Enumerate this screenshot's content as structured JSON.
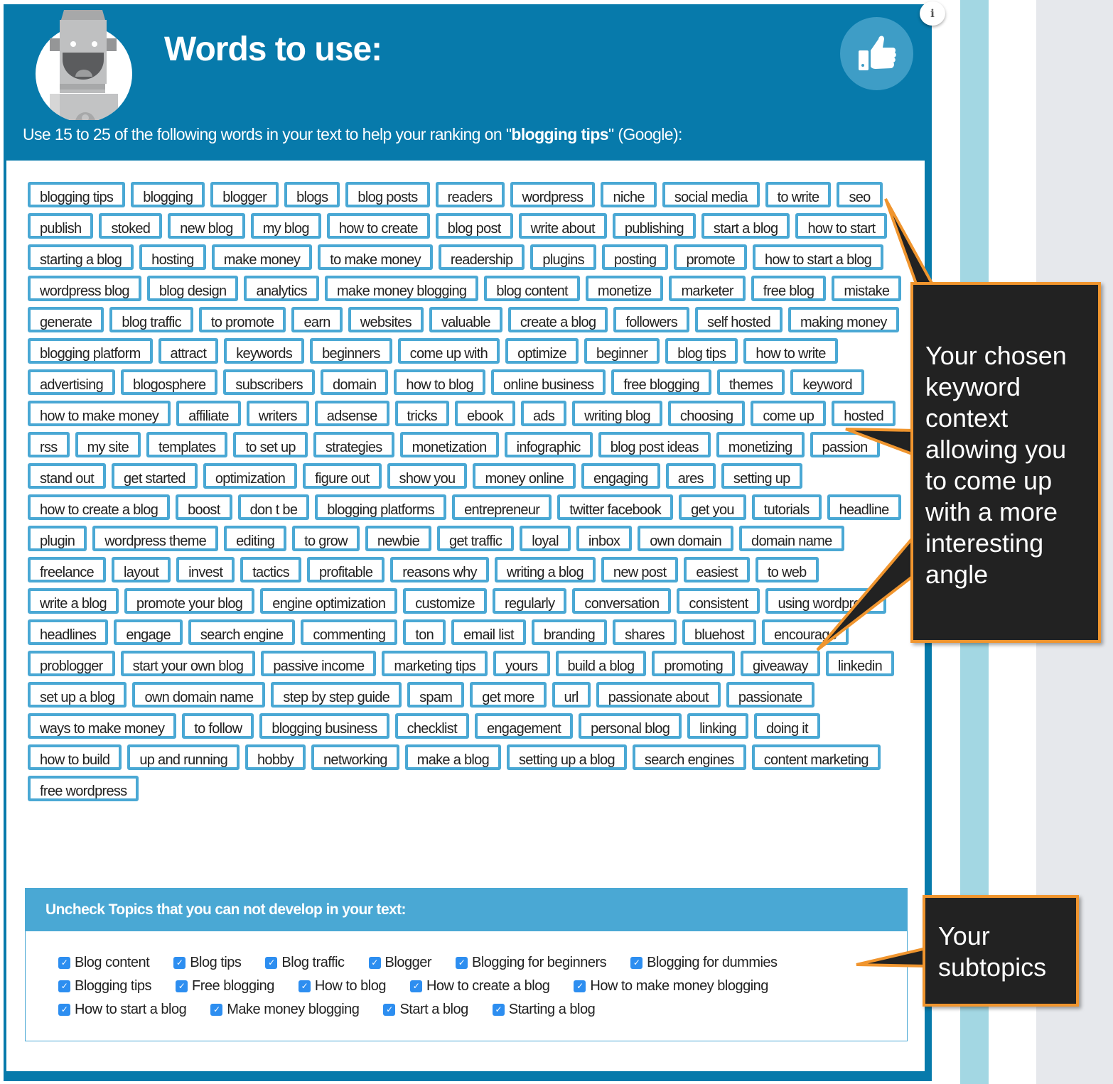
{
  "header": {
    "title": "Words to use:",
    "subtitle_prefix": "Use 15 to 25 of the following words in your text to help your ranking on \"",
    "keyword": "blogging tips",
    "subtitle_suffix": "\" (Google):",
    "info_icon": "info-icon",
    "thumb_icon": "thumbs-up-icon",
    "avatar_icon": "robot-avatar-icon"
  },
  "words": [
    "blogging tips",
    "blogging",
    "blogger",
    "blogs",
    "blog posts",
    "readers",
    "wordpress",
    "niche",
    "social media",
    "to write",
    "seo",
    "publish",
    "stoked",
    "new blog",
    "my blog",
    "how to create",
    "blog post",
    "write about",
    "publishing",
    "start a blog",
    "how to start",
    "starting a blog",
    "hosting",
    "make money",
    "to make money",
    "readership",
    "plugins",
    "posting",
    "promote",
    "how to start a blog",
    "wordpress blog",
    "blog design",
    "analytics",
    "make money blogging",
    "blog content",
    "monetize",
    "marketer",
    "free blog",
    "mistake",
    "generate",
    "blog traffic",
    "to promote",
    "earn",
    "websites",
    "valuable",
    "create a blog",
    "followers",
    "self hosted",
    "making money",
    "blogging platform",
    "attract",
    "keywords",
    "beginners",
    "come up with",
    "optimize",
    "beginner",
    "blog tips",
    "how to write",
    "advertising",
    "blogosphere",
    "subscribers",
    "domain",
    "how to blog",
    "online business",
    "free blogging",
    "themes",
    "keyword",
    "how to make money",
    "affiliate",
    "writers",
    "adsense",
    "tricks",
    "ebook",
    "ads",
    "writing blog",
    "choosing",
    "come up",
    "hosted",
    "rss",
    "my site",
    "templates",
    "to set up",
    "strategies",
    "monetization",
    "infographic",
    "blog post ideas",
    "monetizing",
    "passion",
    "stand out",
    "get started",
    "optimization",
    "figure out",
    "show you",
    "money online",
    "engaging",
    "ares",
    "setting up",
    "how to create a blog",
    "boost",
    "don t be",
    "blogging platforms",
    "entrepreneur",
    "twitter facebook",
    "get you",
    "tutorials",
    "headline",
    "plugin",
    "wordpress theme",
    "editing",
    "to grow",
    "newbie",
    "get traffic",
    "loyal",
    "inbox",
    "own domain",
    "domain name",
    "freelance",
    "layout",
    "invest",
    "tactics",
    "profitable",
    "reasons why",
    "writing a blog",
    "new post",
    "easiest",
    "to web",
    "write a blog",
    "promote your blog",
    "engine optimization",
    "customize",
    "regularly",
    "conversation",
    "consistent",
    "using wordpress",
    "headlines",
    "engage",
    "search engine",
    "commenting",
    "ton",
    "email list",
    "branding",
    "shares",
    "bluehost",
    "encourage",
    "problogger",
    "start your own blog",
    "passive income",
    "marketing tips",
    "yours",
    "build a blog",
    "promoting",
    "giveaway",
    "linkedin",
    "set up a blog",
    "own domain name",
    "step by step guide",
    "spam",
    "get more",
    "url",
    "passionate about",
    "passionate",
    "ways to make money",
    "to follow",
    "blogging business",
    "checklist",
    "engagement",
    "personal blog",
    "linking",
    "doing it",
    "how to build",
    "up and running",
    "hobby",
    "networking",
    "make a blog",
    "setting up a blog",
    "search engines",
    "content marketing",
    "free wordpress"
  ],
  "topics": {
    "heading": "Uncheck Topics that you can not develop in your text:",
    "items": [
      {
        "label": "Blog content",
        "checked": true
      },
      {
        "label": "Blog tips",
        "checked": true
      },
      {
        "label": "Blog traffic",
        "checked": true
      },
      {
        "label": "Blogger",
        "checked": true
      },
      {
        "label": "Blogging for beginners",
        "checked": true
      },
      {
        "label": "Blogging for dummies",
        "checked": true
      },
      {
        "label": "Blogging tips",
        "checked": true
      },
      {
        "label": "Free blogging",
        "checked": true
      },
      {
        "label": "How to blog",
        "checked": true
      },
      {
        "label": "How to create a blog",
        "checked": true
      },
      {
        "label": "How to make money blogging",
        "checked": true
      },
      {
        "label": "How to start a blog",
        "checked": true
      },
      {
        "label": "Make money blogging",
        "checked": true
      },
      {
        "label": "Start a blog",
        "checked": true
      },
      {
        "label": "Starting a blog",
        "checked": true
      }
    ],
    "rows": [
      6,
      5,
      4
    ]
  },
  "callouts": {
    "keyword_context": "Your chosen\nkeyword\ncontext\nallowing you\nto come up\nwith a more\ninteresting\nangle",
    "subtopics": "Your\nsubtopics"
  },
  "colors": {
    "panel": "#077aab",
    "tag_border": "#4aa8d4",
    "checkbox": "#2d8ef0",
    "callout_border": "#f0952e",
    "callout_bg": "#222222"
  }
}
